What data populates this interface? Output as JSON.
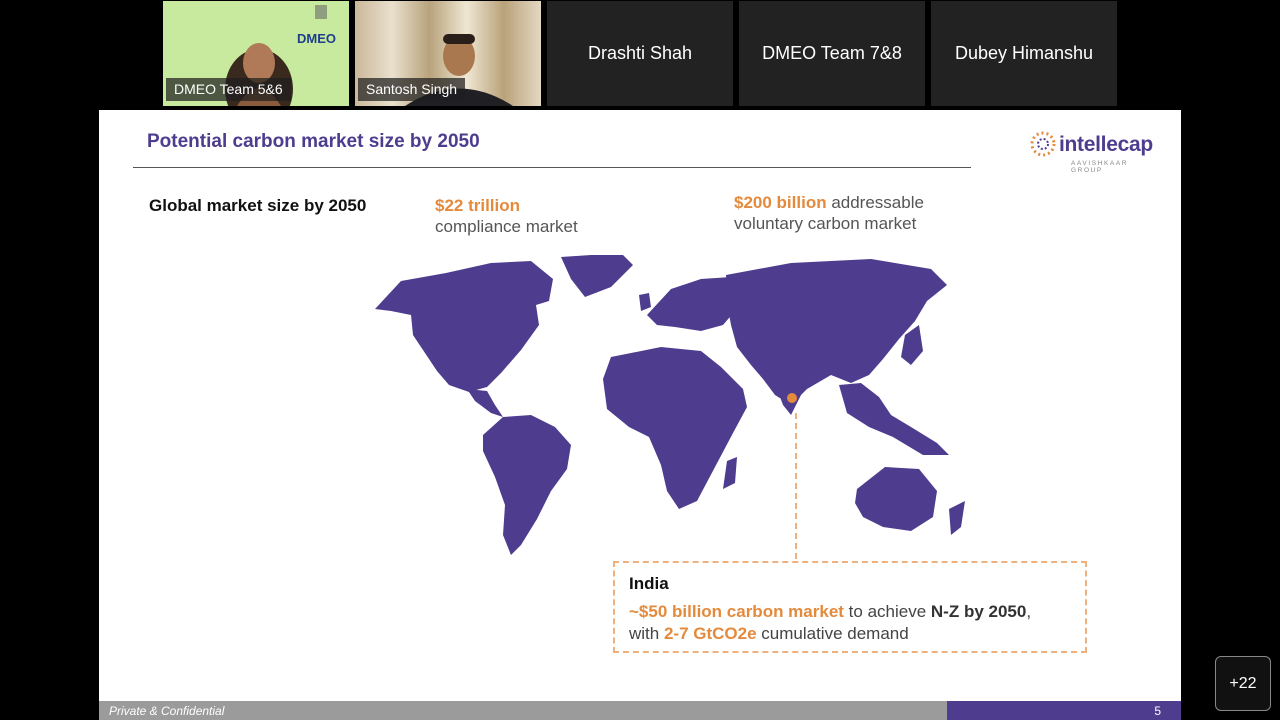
{
  "participants": [
    {
      "name": "DMEO Team 5&6",
      "video": true
    },
    {
      "name": "Santosh Singh",
      "video": true
    },
    {
      "name": "Drashti Shah",
      "video": false
    },
    {
      "name": "DMEO Team 7&8",
      "video": false
    },
    {
      "name": "Dubey Himanshu",
      "video": false
    }
  ],
  "slide": {
    "title": "Potential carbon market size by 2050",
    "logo": {
      "name": "intellecap",
      "sub": "AAVISHKAAR GROUP"
    },
    "global_label": "Global market size by 2050",
    "stat1": {
      "value": "$22 trillion",
      "desc": "compliance market"
    },
    "stat2": {
      "value": "$200 billion",
      "desc_a": " addressable",
      "desc_b": "voluntary carbon market"
    },
    "callout": {
      "title": "India",
      "l1_hl": "~$50 billion carbon market",
      "l1_text": " to achieve ",
      "l1_dark": "N-Z by 2050",
      "l1_end": ",",
      "l2_text": "with ",
      "l2_hl": "2-7 GtCO2e",
      "l2_end": " cumulative demand"
    },
    "footer_text": "Private & Confidential",
    "page_number": "5"
  },
  "more_participants": "+22",
  "colors": {
    "brand_purple": "#4e3d8f",
    "accent_orange": "#e48a3c",
    "map_fill": "#4e3d8f"
  }
}
